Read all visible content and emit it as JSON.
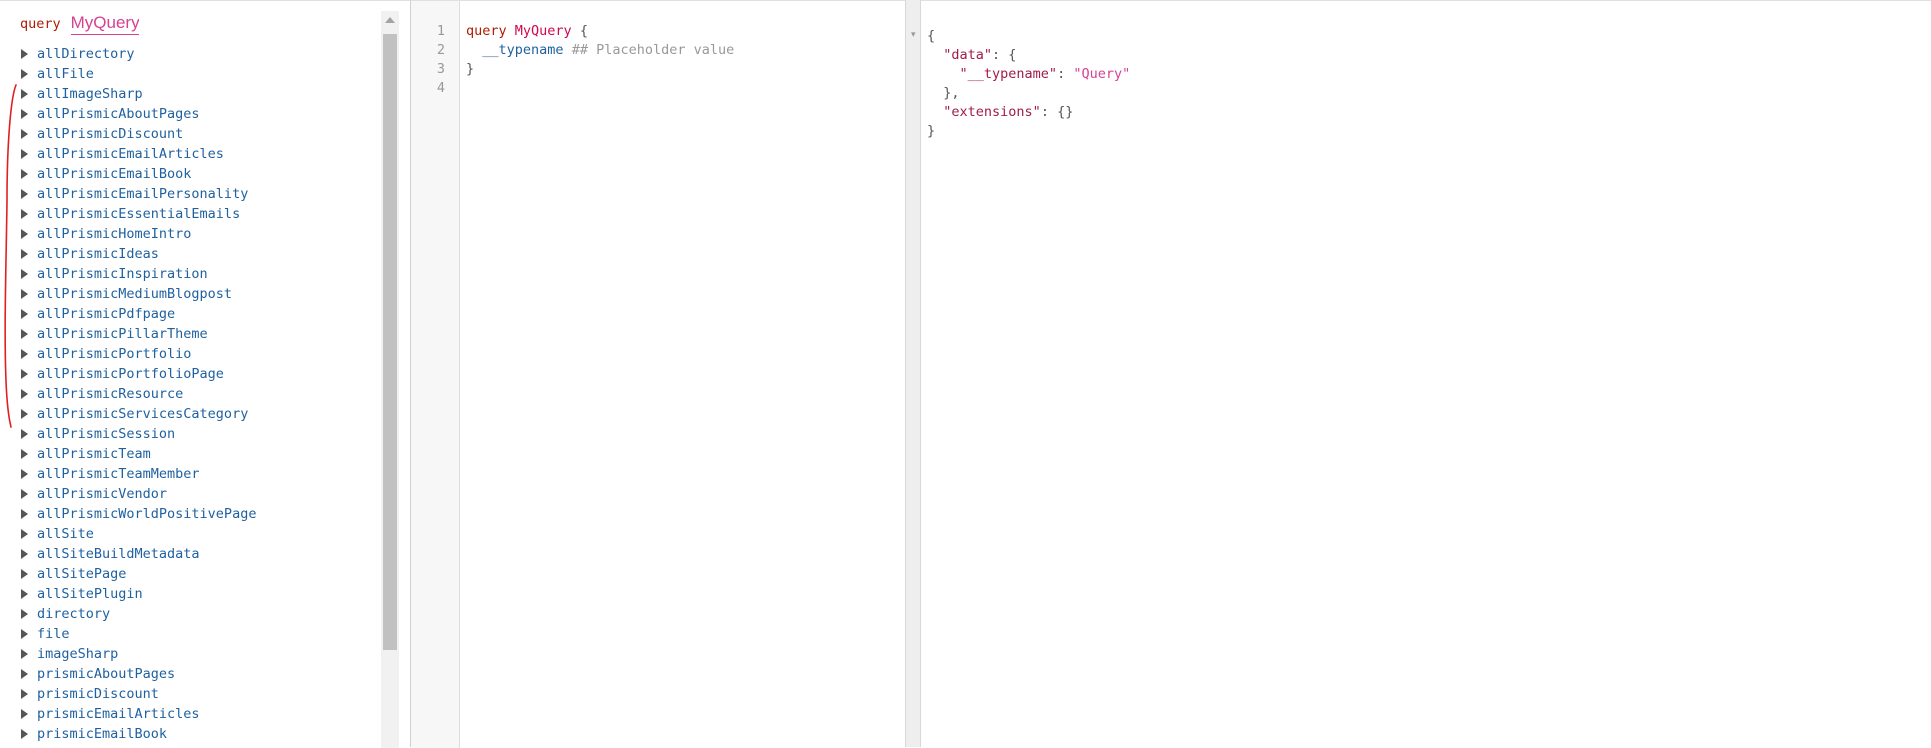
{
  "explorer": {
    "operation_keyword": "query",
    "operation_name": "MyQuery",
    "fields": [
      "allDirectory",
      "allFile",
      "allImageSharp",
      "allPrismicAboutPages",
      "allPrismicDiscount",
      "allPrismicEmailArticles",
      "allPrismicEmailBook",
      "allPrismicEmailPersonality",
      "allPrismicEssentialEmails",
      "allPrismicHomeIntro",
      "allPrismicIdeas",
      "allPrismicInspiration",
      "allPrismicMediumBlogpost",
      "allPrismicPdfpage",
      "allPrismicPillarTheme",
      "allPrismicPortfolio",
      "allPrismicPortfolioPage",
      "allPrismicResource",
      "allPrismicServicesCategory",
      "allPrismicSession",
      "allPrismicTeam",
      "allPrismicTeamMember",
      "allPrismicVendor",
      "allPrismicWorldPositivePage",
      "allSite",
      "allSiteBuildMetadata",
      "allSitePage",
      "allSitePlugin",
      "directory",
      "file",
      "imageSharp",
      "prismicAboutPages",
      "prismicDiscount",
      "prismicEmailArticles",
      "prismicEmailBook"
    ]
  },
  "editor": {
    "line_numbers": [
      "1",
      "2",
      "3",
      "4"
    ],
    "line1": {
      "keyword": "query",
      "name": "MyQuery",
      "brace": "{"
    },
    "line2": {
      "field": "__typename",
      "comment": "## Placeholder value"
    },
    "line3": {
      "brace": "}"
    }
  },
  "result": {
    "fold_marker": "▾",
    "open_brace": "{",
    "data_key": "\"data\"",
    "data_colon_brace": ": {",
    "typename_key": "\"__typename\"",
    "colon": ": ",
    "typename_value": "\"Query\"",
    "data_close": "},",
    "extensions_key": "\"extensions\"",
    "extensions_value": ": {}",
    "close_brace": "}"
  },
  "colors": {
    "keyword": "#b11a04",
    "field": "#1f61a0",
    "def_name": "#d2054e",
    "string": "#d64292",
    "annotation": "#e02020"
  }
}
